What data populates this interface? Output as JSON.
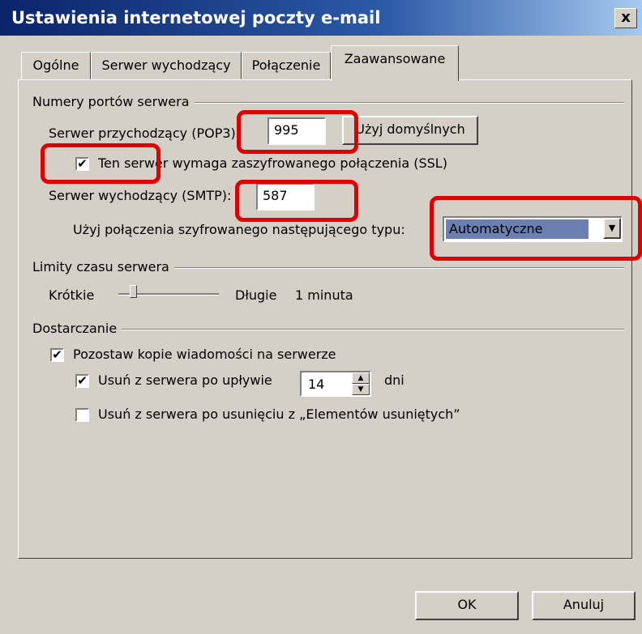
{
  "window": {
    "title": "Ustawienia internetowej poczty e-mail",
    "close_glyph": "x"
  },
  "tabs": [
    {
      "label": "Ogólne"
    },
    {
      "label": "Serwer wychodzący"
    },
    {
      "label": "Połączenie"
    },
    {
      "label": "Zaawansowane",
      "active": true
    }
  ],
  "ports": {
    "group_label": "Numery portów serwera",
    "incoming_label": "Serwer przychodzący (POP3):",
    "incoming_value": "995",
    "default_button": "Użyj domyślnych",
    "ssl_label": "Ten serwer wymaga zaszyfrowanego połączenia (SSL)",
    "ssl_checked": true,
    "outgoing_label": "Serwer wychodzący (SMTP):",
    "outgoing_value": "587",
    "encryption_label": "Użyj połączenia szyfrowanego następującego typu:",
    "encryption_value": "Automatyczne"
  },
  "timeouts": {
    "group_label": "Limity czasu serwera",
    "short_label": "Krótkie",
    "long_label": "Długie",
    "value_text": "1 minuta"
  },
  "delivery": {
    "group_label": "Dostarczanie",
    "leave_copy_label": "Pozostaw kopie wiadomości na serwerze",
    "leave_copy_checked": true,
    "remove_after_label": "Usuń z serwera po upływie",
    "remove_after_checked": true,
    "remove_after_days": "14",
    "days_unit": "dni",
    "remove_deleted_label": "Usuń z serwera po usunięciu z „Elementów usuniętych”",
    "remove_deleted_checked": false
  },
  "buttons": {
    "ok": "OK",
    "cancel": "Anuluj"
  },
  "glyphs": {
    "check": "✔",
    "dropdown": "▼",
    "spin_up": "▲",
    "spin_down": "▼"
  },
  "colors": {
    "title_bar": "#0a246a",
    "highlight_box": "#e00000",
    "selection": "#6b7fb0"
  }
}
